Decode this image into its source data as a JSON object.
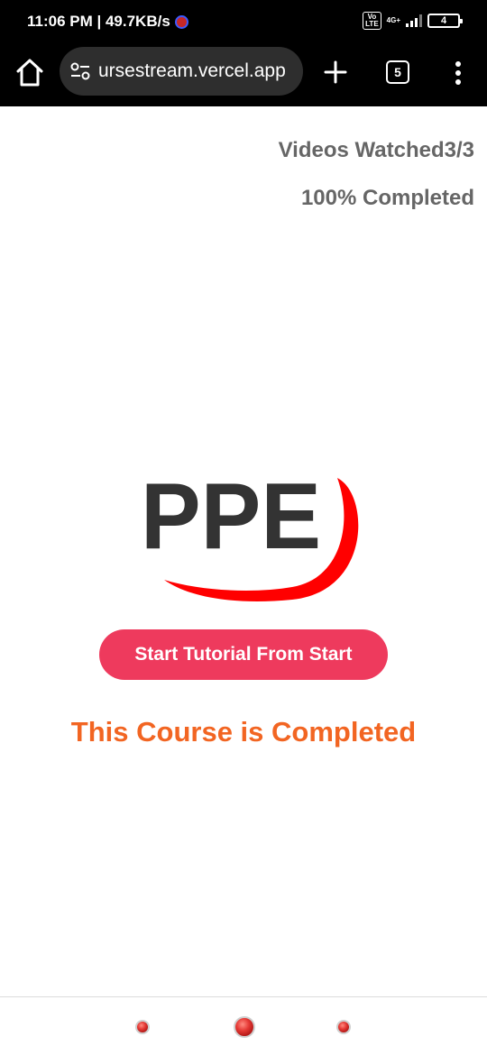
{
  "status_bar": {
    "time_speed": "11:06 PM | 49.7KB/s",
    "volte": "Vo\nLTE",
    "network": "4G+",
    "battery": "4"
  },
  "browser": {
    "url": "ursestream.vercel.app",
    "tab_count": "5",
    "icons": {
      "home": "home-icon",
      "site_settings": "tune-icon",
      "new_tab": "plus-icon",
      "menu": "more-vertical-icon"
    }
  },
  "progress": {
    "videos_watched": "Videos Watched3/3",
    "percent_completed": "100% Completed"
  },
  "logo": {
    "text": "PPE",
    "text_color": "#333333",
    "swoosh_color": "#ff0000"
  },
  "actions": {
    "start_button": "Start Tutorial From Start"
  },
  "status_message": "This Course is Completed",
  "colors": {
    "button": "#ee3a5d",
    "message": "#f26522",
    "stats": "#666666"
  }
}
